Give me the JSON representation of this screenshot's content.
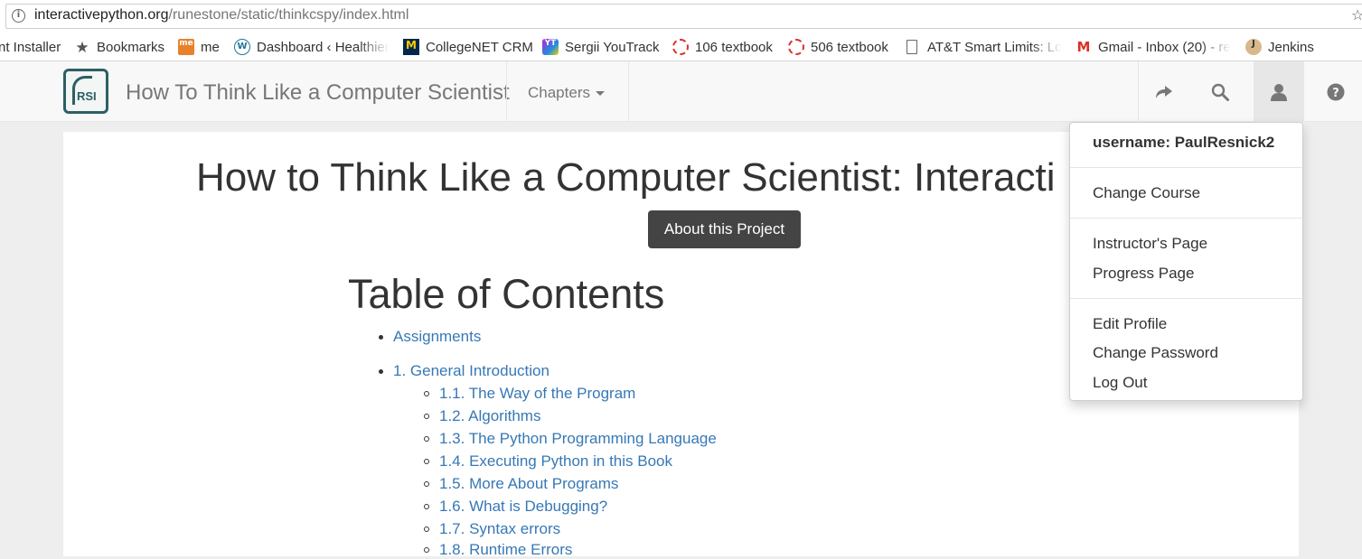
{
  "browser": {
    "url_host": "interactivepython.org",
    "url_path": "/runestone/static/thinkcspy/index.html",
    "bookmarks": [
      {
        "label": "nt Installer",
        "icon": "none"
      },
      {
        "label": "Bookmarks",
        "icon": "star-icon"
      },
      {
        "label": "me",
        "icon": "me-favicon"
      },
      {
        "label": "Dashboard ‹ Healthier",
        "icon": "wordpress-icon"
      },
      {
        "label": "CollegeNET CRM",
        "icon": "michigan-m-icon"
      },
      {
        "label": "Sergii YouTrack",
        "icon": "youtrack-icon"
      },
      {
        "label": "106 textbook",
        "icon": "runestone-icon"
      },
      {
        "label": "506 textbook",
        "icon": "runestone-icon"
      },
      {
        "label": "AT&T Smart Limits: Lo",
        "icon": "page-icon"
      },
      {
        "label": "Gmail - Inbox (20) - re",
        "icon": "gmail-icon"
      },
      {
        "label": "Jenkins",
        "icon": "jenkins-icon"
      }
    ]
  },
  "navbar": {
    "logo_text": "RSI",
    "brand": "How To Think Like a Computer Scientist",
    "chapters_label": "Chapters",
    "icons": [
      "share-icon",
      "search-icon",
      "user-icon",
      "help-icon"
    ]
  },
  "content": {
    "title": "How to Think Like a Computer Scientist: Interacti",
    "about_button": "About this Project",
    "toc_title": "Table of Contents",
    "toc": [
      {
        "label": "Assignments",
        "children": []
      },
      {
        "label": "1. General Introduction",
        "children": [
          "1.1. The Way of the Program",
          "1.2. Algorithms",
          "1.3. The Python Programming Language",
          "1.4. Executing Python in this Book",
          "1.5. More About Programs",
          "1.6. What is Debugging?",
          "1.7. Syntax errors",
          "1.8. Runtime Errors"
        ]
      }
    ]
  },
  "user_menu": {
    "username": "username: PaulResnick2",
    "change_course": "Change Course",
    "instructors_page": "Instructor's Page",
    "progress_page": "Progress Page",
    "edit_profile": "Edit Profile",
    "change_password": "Change Password",
    "log_out": "Log Out"
  },
  "colors": {
    "link": "#3778b6",
    "navbar_bg": "#f8f8f8",
    "button_bg": "#444444",
    "page_bg": "#eeeeee"
  }
}
